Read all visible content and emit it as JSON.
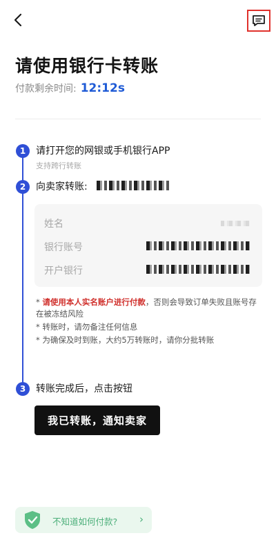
{
  "header": {
    "back_icon": "chevron-left-icon",
    "message_icon": "message-icon",
    "accent_color": "#e0302b"
  },
  "page": {
    "title": "请使用银行卡转账",
    "timer_label": "付款剩余时间:",
    "timer_value": "12:12s",
    "timer_color": "#1f5bd6"
  },
  "steps": [
    {
      "number": "1",
      "title": "请打开您的网银或手机银行APP",
      "subtitle": "支持跨行转账"
    },
    {
      "number": "2",
      "title": "向卖家转账:"
    },
    {
      "number": "3",
      "title": "转账完成后，点击按钮"
    }
  ],
  "account_card": {
    "rows": [
      {
        "label": "姓名"
      },
      {
        "label": "银行账号"
      },
      {
        "label": "开户银行"
      }
    ]
  },
  "notes": {
    "line1_prefix": "* ",
    "line1_warn": "请使用本人实名账户进行付款",
    "line1_rest": "，否则会导致订单失败且账号存在被冻结风险",
    "line2": "* 转账时，请勿备注任何信息",
    "line3": "* 为确保及时到账，大约5万转账时，请你分批转账"
  },
  "action": {
    "notify_label": "我已转账，通知卖家"
  },
  "help": {
    "label": "不知道如何付款?",
    "chevron": "›",
    "icon": "shield-check-icon",
    "color": "#4caf7a"
  },
  "step_color": "#2f4fd6"
}
